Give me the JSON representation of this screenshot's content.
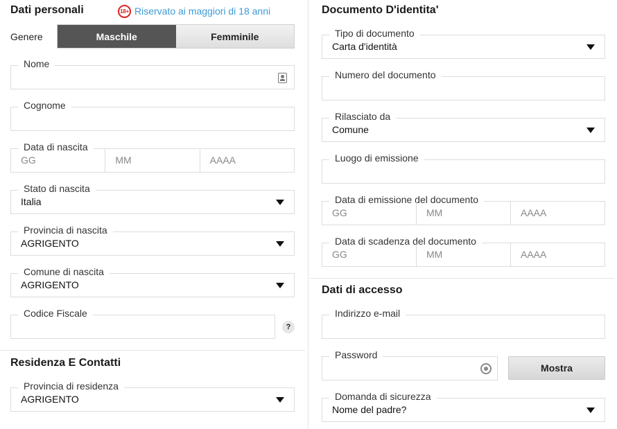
{
  "personal": {
    "heading": "Dati personali",
    "age_badge": "18+",
    "age_note": "Riservato ai maggiori di 18 anni",
    "gender_label": "Genere",
    "gender_options": [
      "Maschile",
      "Femminile"
    ],
    "gender_selected": "Maschile",
    "nome_label": "Nome",
    "cognome_label": "Cognome",
    "birthdate_label": "Data di nascita",
    "date_placeholders": [
      "GG",
      "MM",
      "AAAA"
    ],
    "birth_country_label": "Stato di nascita",
    "birth_country_value": "Italia",
    "birth_province_label": "Provincia di nascita",
    "birth_province_value": "AGRIGENTO",
    "birth_city_label": "Comune di nascita",
    "birth_city_value": "AGRIGENTO",
    "tax_code_label": "Codice Fiscale",
    "help_label": "?"
  },
  "residence": {
    "heading": "Residenza E Contatti",
    "province_label": "Provincia di residenza",
    "province_value": "AGRIGENTO"
  },
  "document": {
    "heading": "Documento D'identita'",
    "type_label": "Tipo di documento",
    "type_value": "Carta d'identità",
    "number_label": "Numero del documento",
    "issuer_label": "Rilasciato da",
    "issuer_value": "Comune",
    "place_label": "Luogo di emissione",
    "issue_date_label": "Data di emissione del documento",
    "expiry_date_label": "Data di scadenza del documento",
    "date_placeholders": [
      "GG",
      "MM",
      "AAAA"
    ]
  },
  "access": {
    "heading": "Dati di accesso",
    "email_label": "Indirizzo e-mail",
    "password_label": "Password",
    "show_button": "Mostra",
    "security_question_label": "Domanda di sicurezza",
    "security_question_value": "Nome del padre?"
  },
  "colors": {
    "badge_red": "#dd2222",
    "link_blue": "#3d9ad6",
    "toggle_active": "#555555"
  }
}
